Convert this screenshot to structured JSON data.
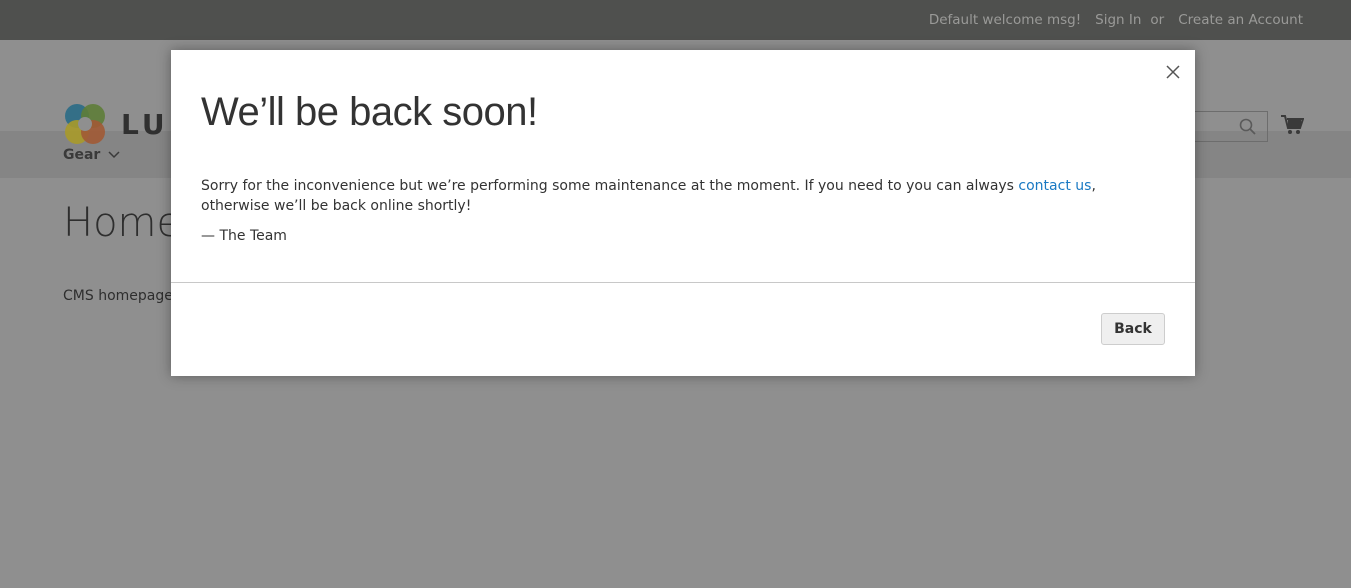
{
  "topbar": {
    "welcome": "Default welcome msg!",
    "sign_in": "Sign In",
    "or": "or",
    "create_account": "Create an Account"
  },
  "header": {
    "logo_text": "LUMA"
  },
  "nav": {
    "items": [
      {
        "label": "Gear"
      }
    ]
  },
  "page": {
    "title": "Home Page",
    "content": "CMS homepage content goes here."
  },
  "modal": {
    "title": "We’ll be back soon!",
    "message_before": "Sorry for the inconvenience but we’re performing some maintenance at the moment. If you need to you can always ",
    "link": "contact us",
    "message_after": ", otherwise we’ll be back online shortly!",
    "signature": "— The Team",
    "back_label": "Back"
  },
  "colors": {
    "link": "#1979c3",
    "overlay_topbar": "#4f504e",
    "overlay_bg": "#8f8f8f"
  }
}
